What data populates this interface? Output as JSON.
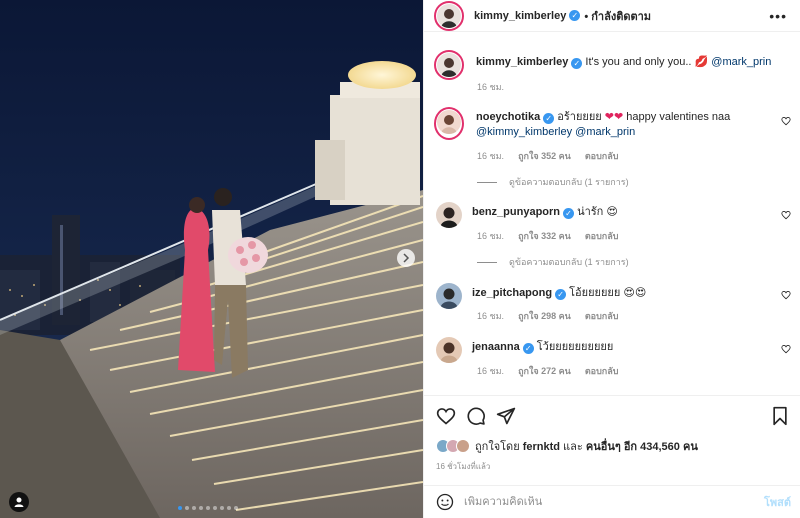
{
  "header": {
    "username": "kimmy_kimberley",
    "follow_status": "• กำลังติดตาม",
    "more_label": "•••"
  },
  "caption": {
    "username": "kimmy_kimberley",
    "text": "It's you and only you..",
    "mention": "@mark_prin",
    "time": "16 ชม."
  },
  "comments": [
    {
      "username": "noeychotika",
      "text": "อร้ายยยย",
      "text2": "happy valentines naa",
      "mentions": "@kimmy_kimberley @mark_prin",
      "time": "16 ชม.",
      "likes": "ถูกใจ 352 คน",
      "reply": "ตอบกลับ",
      "view_replies": "ดูข้อความตอบกลับ (1 รายการ)"
    },
    {
      "username": "benz_punyaporn",
      "text": "น่ารัก",
      "time": "16 ชม.",
      "likes": "ถูกใจ 332 คน",
      "reply": "ตอบกลับ",
      "view_replies": "ดูข้อความตอบกลับ (1 รายการ)"
    },
    {
      "username": "ize_pitchapong",
      "text": "โอ้ยยยยยย",
      "time": "16 ชม.",
      "likes": "ถูกใจ 298 คน",
      "reply": "ตอบกลับ"
    },
    {
      "username": "jenaanna",
      "text": "โว้ยยยยยยยยยย",
      "time": "16 ชม.",
      "likes": "ถูกใจ 272 คน",
      "reply": "ตอบกลับ"
    }
  ],
  "likes_summary": {
    "prefix": "ถูกใจโดย",
    "user": "fernktd",
    "middle": "และ",
    "others": "คนอื่นๆ อีก 434,560 คน"
  },
  "post_time": "16 ชั่วโมงที่แล้ว",
  "add_comment": {
    "placeholder": "เพิ่มความคิดเห็น",
    "post_label": "โพสต์"
  },
  "carousel": {
    "count": 9,
    "active_index": 0
  },
  "colors": {
    "accent": "#3897f0",
    "verified": "#3897f0",
    "heart": "#ed4956",
    "link": "#00376b"
  },
  "icons": [
    "heart-icon",
    "comment-icon",
    "share-icon",
    "save-icon",
    "emoji-icon",
    "more-icon",
    "verified-icon",
    "next-arrow-icon",
    "tag-user-icon"
  ]
}
